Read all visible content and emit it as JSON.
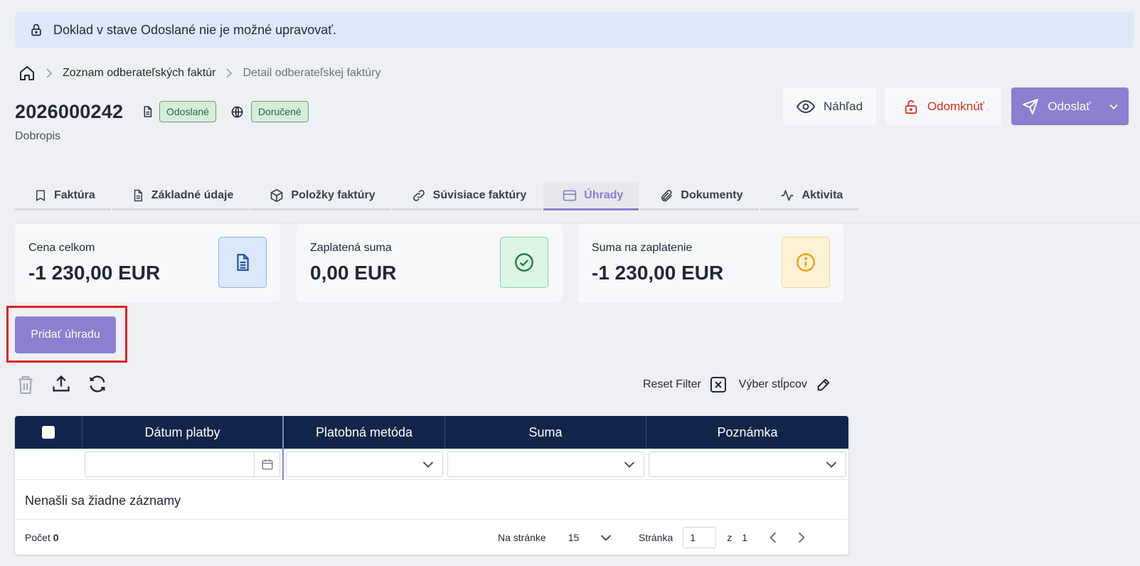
{
  "banner": {
    "text": "Doklad v stave Odoslané nie je možné upravovať."
  },
  "breadcrumb": {
    "items": [
      "Zoznam odberateľských faktúr",
      "Detail odberateľskej faktúry"
    ]
  },
  "document": {
    "number": "2026000242",
    "subtitle": "Dobropis",
    "status_badge": "Odoslané",
    "delivery_badge": "Doručené"
  },
  "actions": {
    "preview": "Náhľad",
    "unlock": "Odomknúť",
    "send": "Odoslať"
  },
  "tabs": [
    {
      "label": "Faktúra",
      "icon": "receipt-icon"
    },
    {
      "label": "Základné údaje",
      "icon": "document-icon"
    },
    {
      "label": "Položky faktúry",
      "icon": "box-icon"
    },
    {
      "label": "Súvisiace faktúry",
      "icon": "link-icon"
    },
    {
      "label": "Úhrady",
      "icon": "card-icon",
      "active": true
    },
    {
      "label": "Dokumenty",
      "icon": "paperclip-icon"
    },
    {
      "label": "Aktivita",
      "icon": "activity-icon"
    }
  ],
  "cards": [
    {
      "label": "Cena celkom",
      "value": "-1 230,00 EUR",
      "icon": "document-icon",
      "color": "#1e4fa3"
    },
    {
      "label": "Zaplatená suma",
      "value": "0,00 EUR",
      "icon": "check-circle-icon",
      "color": "#1f7a45"
    },
    {
      "label": "Suma na zaplatenie",
      "value": "-1 230,00 EUR",
      "icon": "info-circle-icon",
      "color": "#f29a13"
    }
  ],
  "add_payment": {
    "label": "Pridať úhradu"
  },
  "toolbar": {
    "reset_filter": "Reset Filter",
    "column_select": "Výber stĺpcov"
  },
  "grid": {
    "columns": [
      "Dátum platby",
      "Platobná metóda",
      "Suma",
      "Poznámka"
    ],
    "empty_message": "Nenašli sa žiadne záznamy"
  },
  "footer": {
    "count_label": "Počet",
    "count_value": "0",
    "per_page_label": "Na stránke",
    "per_page_value": "15",
    "page_label": "Stránka",
    "page_value": "1",
    "of_label": "z",
    "total_pages": "1"
  },
  "colors": {
    "accent": "#8b7fd0",
    "header": "#10254a",
    "danger": "#dc2f1f"
  }
}
